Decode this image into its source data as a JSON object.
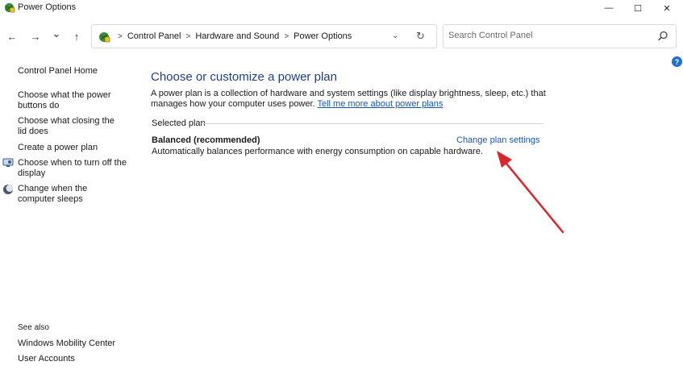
{
  "window": {
    "title": "Power Options",
    "controls": {
      "minimize": "—",
      "maximize": "☐",
      "close": "✕"
    }
  },
  "nav": {
    "back": "←",
    "forward": "→",
    "recent": "⌄",
    "up": "↑",
    "breadcrumbs": [
      "Control Panel",
      "Hardware and Sound",
      "Power Options"
    ],
    "breadcrumb_sep": ">",
    "dropdown": "⌄",
    "refresh": "↻"
  },
  "search": {
    "placeholder": "Search Control Panel"
  },
  "help": "?",
  "sidebar": {
    "home": "Control Panel Home",
    "links": [
      "Choose what the power buttons do",
      "Choose what closing the lid does",
      "Create a power plan",
      "Choose when to turn off the display",
      "Change when the computer sleeps"
    ],
    "see_also_label": "See also",
    "see_also": [
      "Windows Mobility Center",
      "User Accounts"
    ]
  },
  "main": {
    "heading": "Choose or customize a power plan",
    "description": "A power plan is a collection of hardware and system settings (like display brightness, sleep, etc.) that manages how your computer uses power.",
    "tell_me_link": "Tell me more about power plans",
    "selected_plan_label": "Selected plan",
    "plan": {
      "name": "Balanced (recommended)",
      "description": "Automatically balances performance with energy consumption on capable hardware.",
      "change_link": "Change plan settings"
    }
  },
  "colors": {
    "heading": "#1e3f87",
    "link": "#1556b8",
    "annotation_arrow": "#d9262b"
  }
}
